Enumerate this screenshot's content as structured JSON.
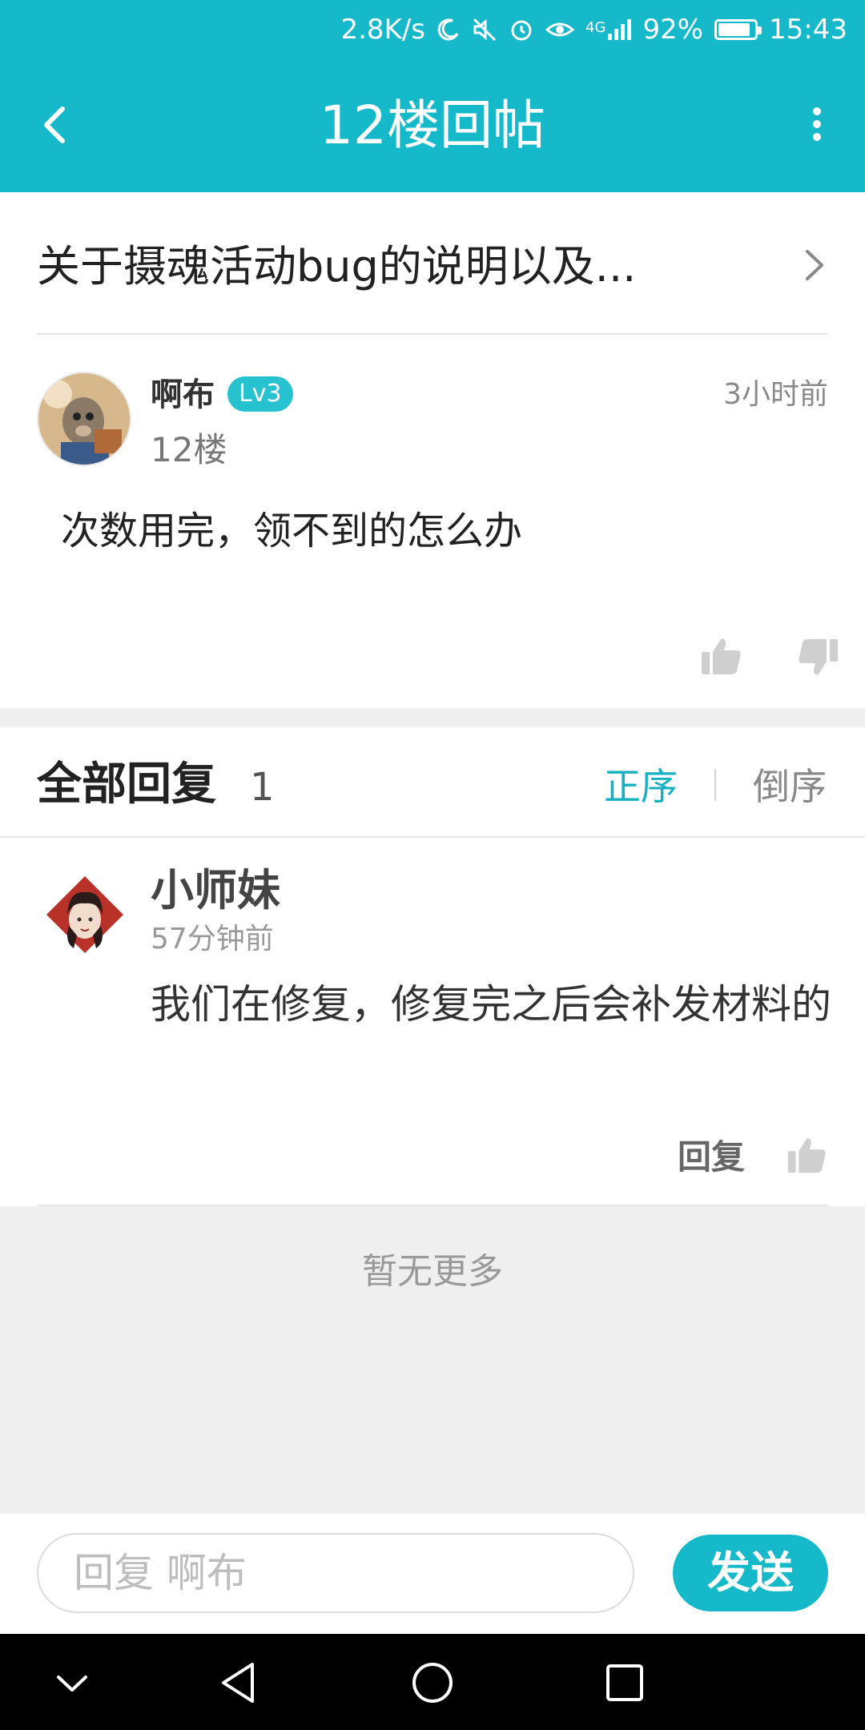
{
  "status_bar": {
    "net_speed": "2.8K/s",
    "signal_label": "4G",
    "battery": "92%",
    "battery_level": 0.92,
    "time": "15:43",
    "icons": [
      "moon-icon",
      "mute-icon",
      "alarm-icon",
      "eye-icon",
      "signal-icon",
      "battery-icon"
    ]
  },
  "header": {
    "title": "12楼回帖",
    "back_icon": "chevron-left-icon",
    "more_icon": "more-vertical-icon"
  },
  "thread": {
    "title": "关于摄魂活动bug的说明以及...",
    "chevron_icon": "chevron-right-icon"
  },
  "post": {
    "author": "啊布",
    "level": "Lv3",
    "time": "3小时前",
    "floor": "12楼",
    "body": "次数用完，领不到的怎么办",
    "like_icon": "thumbs-up-icon",
    "dislike_icon": "thumbs-down-icon"
  },
  "replies": {
    "label": "全部回复",
    "count": "1",
    "sort_asc": "正序",
    "sort_desc": "倒序",
    "items": [
      {
        "author": "小师妹",
        "time": "57分钟前",
        "body": "我们在修复，修复完之后会补发材料的",
        "reply_label": "回复"
      }
    ]
  },
  "no_more": "暂无更多",
  "input_bar": {
    "placeholder": "回复 啊布",
    "send_label": "发送"
  },
  "colors": {
    "accent": "#16b9c9",
    "level_badge": "#26c2cf",
    "background_gray": "#efefef"
  }
}
